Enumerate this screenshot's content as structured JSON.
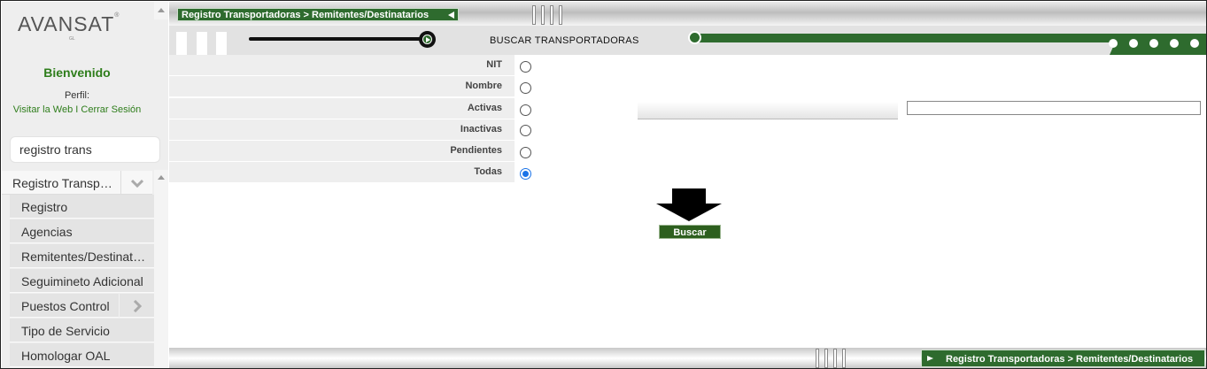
{
  "sidebar": {
    "logo": "AVANSAT",
    "logo_mark": "®",
    "logo_sub": "GL",
    "welcome": "Bienvenido",
    "profile_label": "Perfil:",
    "visit_link": "Visitar la Web",
    "link_separator": " I ",
    "logout_link": "Cerrar Sesión",
    "search_value": "registro trans",
    "menu_parent": "Registro Transportadoras",
    "menu_items": [
      {
        "label": "Registro",
        "has_submenu": false
      },
      {
        "label": "Agencias",
        "has_submenu": false
      },
      {
        "label": "Remitentes/Destinatarios",
        "has_submenu": false
      },
      {
        "label": "Seguimineto Adicional",
        "has_submenu": false
      },
      {
        "label": "Puestos Control",
        "has_submenu": true
      },
      {
        "label": "Tipo de Servicio",
        "has_submenu": false
      },
      {
        "label": "Homologar OAL",
        "has_submenu": false
      }
    ]
  },
  "header": {
    "breadcrumb": "Registro Transportadoras > Remitentes/Destinatarios",
    "section_title": "BUSCAR TRANSPORTADORAS"
  },
  "form": {
    "options": [
      {
        "label": "NIT",
        "checked": false
      },
      {
        "label": "Nombre",
        "checked": false
      },
      {
        "label": "Activas",
        "checked": false
      },
      {
        "label": "Inactivas",
        "checked": false
      },
      {
        "label": "Pendientes",
        "checked": false
      },
      {
        "label": "Todas",
        "checked": true
      }
    ],
    "search_value": "",
    "submit_label": "Buscar"
  },
  "footer": {
    "breadcrumb": "Registro Transportadoras > Remitentes/Destinatarios"
  },
  "colors": {
    "brand_green": "#2e6b2e",
    "welcome_green": "#2e7d1b",
    "radio_blue": "#1a73e8"
  }
}
